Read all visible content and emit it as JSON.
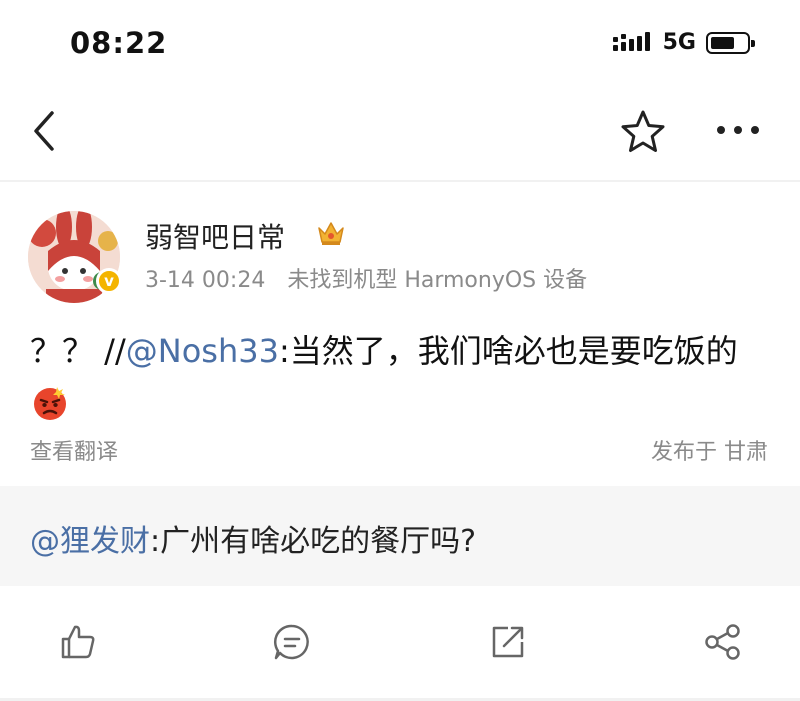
{
  "status_bar": {
    "time": "08:22",
    "network": "5G",
    "battery_level": 0.72,
    "icons": [
      "signal-icon",
      "battery-icon"
    ]
  },
  "nav": {
    "icons": [
      "back-arrow-icon",
      "favorite-star-icon",
      "more-menu-icon"
    ]
  },
  "post": {
    "author": "弱智吧日常",
    "author_badges": [
      "crown-badge-icon",
      "verified-v-icon"
    ],
    "verified_mark": "v",
    "timestamp": "3-14 00:24",
    "device": "未找到机型 HarmonyOS 设备",
    "content": {
      "prefix": "？？ //",
      "mention": "@Nosh33",
      "body": ":当然了，我们啥必也是要吃饭的",
      "emoji": "angry-face-emoji"
    },
    "translate_label": "查看翻译",
    "location_label": "发布于 甘肃"
  },
  "repost": {
    "mention": "@狸发财",
    "body": ":广州有啥必吃的餐厅吗?"
  },
  "actions": {
    "icons": [
      "like-icon",
      "comment-icon",
      "repost-icon",
      "share-icon"
    ]
  },
  "colors": {
    "mention": "#4a6fa5",
    "secondary_text": "#8a8a8a",
    "repost_background": "#f6f6f6",
    "verified_badge": "#f4b400"
  }
}
